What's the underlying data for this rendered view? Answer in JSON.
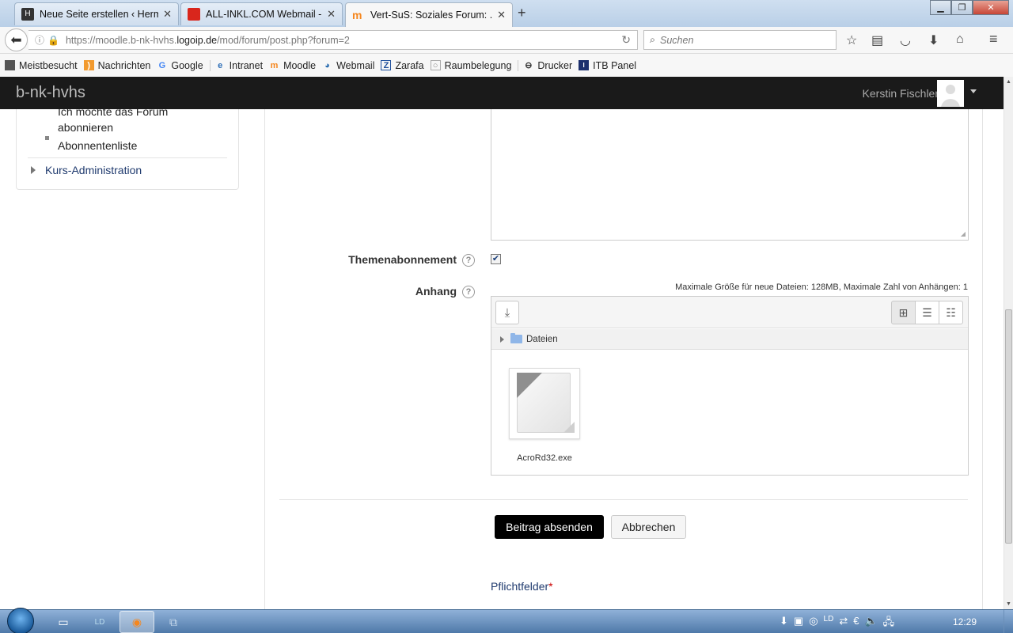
{
  "browser": {
    "tabs": [
      {
        "title": "Neue Seite erstellen ‹ Herm...",
        "color": "#333333"
      },
      {
        "title": "ALL-INKL.COM Webmail - ...",
        "color": "#d9261c"
      },
      {
        "title": "Vert-SuS: Soziales Forum: ...",
        "color": "#f5871f"
      }
    ],
    "url_prefix": "https://moodle.b-nk-hvhs.",
    "url_domain": "logoip.de",
    "url_suffix": "/mod/forum/post.php?forum=2",
    "search_placeholder": "Suchen",
    "bookmarks": [
      "Meistbesucht",
      "Nachrichten",
      "Google",
      "Intranet",
      "Moodle",
      "Webmail",
      "Zarafa",
      "Raumbelegung",
      "Drucker",
      "ITB Panel"
    ]
  },
  "moodle": {
    "brand": "b-nk-hvhs",
    "user_name": "Kerstin Fischler",
    "sidebar": {
      "items": [
        "Ich möchte das Forum abonnieren",
        "Abonnentenliste"
      ],
      "course_admin": "Kurs-Administration"
    },
    "form": {
      "subscription_label": "Themenabonnement",
      "subscription_checked": true,
      "attachment_label": "Anhang",
      "max_info": "Maximale Größe für neue Dateien: 128MB, Maximale Zahl von Anhängen: 1",
      "folder_name": "Dateien",
      "file_name": "AcroRd32.exe",
      "submit_label": "Beitrag absenden",
      "cancel_label": "Abbrechen",
      "required_label": "Pflichtfelder",
      "required_star": "*"
    }
  },
  "taskbar": {
    "clock": "12:29"
  }
}
